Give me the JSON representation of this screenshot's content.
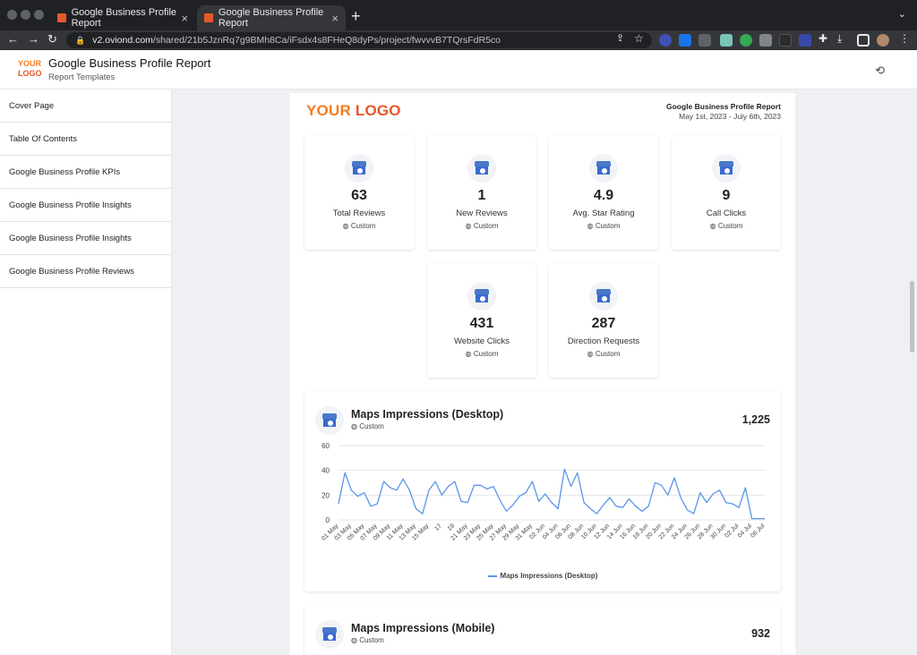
{
  "browser": {
    "tabs": [
      {
        "label": "Google Business Profile Report",
        "active": false
      },
      {
        "label": "Google Business Profile Report",
        "active": true
      }
    ],
    "new_tab": "+",
    "url_host": "v2.oviond.com",
    "url_path": "/shared/21b5JznRq7g9BMh8Ca/iFsdx4s8FHeQ8dyPs/project/fwvvvB7TQrsFdR5co"
  },
  "header": {
    "logo_line1": "YOUR",
    "logo_line2": "LOGO",
    "title": "Google Business Profile Report",
    "subtitle": "Report Templates"
  },
  "sidebar": {
    "items": [
      {
        "label": "Cover Page"
      },
      {
        "label": "Table Of Contents"
      },
      {
        "label": "Google Business Profile KPIs"
      },
      {
        "label": "Google Business Profile Insights"
      },
      {
        "label": "Google Business Profile Insights"
      },
      {
        "label": "Google Business Profile Reviews"
      }
    ]
  },
  "report": {
    "logo_your": "YOUR",
    "logo_logo": "LOGO",
    "title": "Google Business Profile Report",
    "date_range": "May 1st, 2023 - July 6th, 2023"
  },
  "kpis": [
    {
      "value": "63",
      "label": "Total Reviews",
      "source": "◍ Custom"
    },
    {
      "value": "1",
      "label": "New Reviews",
      "source": "◍ Custom"
    },
    {
      "value": "4.9",
      "label": "Avg. Star Rating",
      "source": "◍ Custom"
    },
    {
      "value": "9",
      "label": "Call Clicks",
      "source": "◍ Custom"
    },
    {
      "value": "431",
      "label": "Website Clicks",
      "source": "◍ Custom"
    },
    {
      "value": "287",
      "label": "Direction Requests",
      "source": "◍ Custom"
    }
  ],
  "charts": [
    {
      "title": "Maps Impressions (Desktop)",
      "source": "◍ Custom",
      "total": "1,225",
      "legend": "Maps Impressions (Desktop)"
    },
    {
      "title": "Maps Impressions (Mobile)",
      "source": "◍ Custom",
      "total": "932"
    }
  ],
  "colors": {
    "accent": "#5a96e8",
    "logo_orange": "#f47c20",
    "logo_red": "#e8572b"
  },
  "chart_data": {
    "type": "line",
    "title": "Maps Impressions (Desktop)",
    "ylim": [
      0,
      60
    ],
    "yticks": [
      0,
      20,
      40,
      60
    ],
    "grid": true,
    "legend_position": "bottom",
    "x_tick_labels": [
      "01 May",
      "03 May",
      "05 May",
      "07 May",
      "09 May",
      "11 May",
      "13 May",
      "15 May",
      "17",
      "19",
      "21 May",
      "23 May",
      "25 May",
      "27 May",
      "29 May",
      "31 May",
      "02 Jun",
      "04 Jun",
      "06 Jun",
      "08 Jun",
      "10 Jun",
      "12 Jun",
      "14 Jun",
      "16 Jun",
      "18 Jun",
      "20 Jun",
      "22 Jun",
      "24 Jun",
      "26 Jun",
      "28 Jun",
      "30 Jun",
      "02 Jul",
      "04 Jul",
      "06 Jul"
    ],
    "series": [
      {
        "name": "Maps Impressions (Desktop)",
        "values": [
          13,
          38,
          24,
          19,
          22,
          11,
          13,
          31,
          26,
          24,
          33,
          24,
          9,
          5,
          24,
          31,
          20,
          27,
          31,
          15,
          14,
          28,
          28,
          25,
          27,
          16,
          7,
          12,
          19,
          22,
          31,
          15,
          21,
          14,
          9,
          41,
          27,
          38,
          14,
          9,
          5,
          12,
          18,
          11,
          10,
          17,
          11,
          7,
          11,
          30,
          28,
          20,
          34,
          18,
          8,
          5,
          22,
          14,
          21,
          24,
          14,
          13,
          10,
          26,
          1,
          1,
          1
        ]
      }
    ]
  }
}
